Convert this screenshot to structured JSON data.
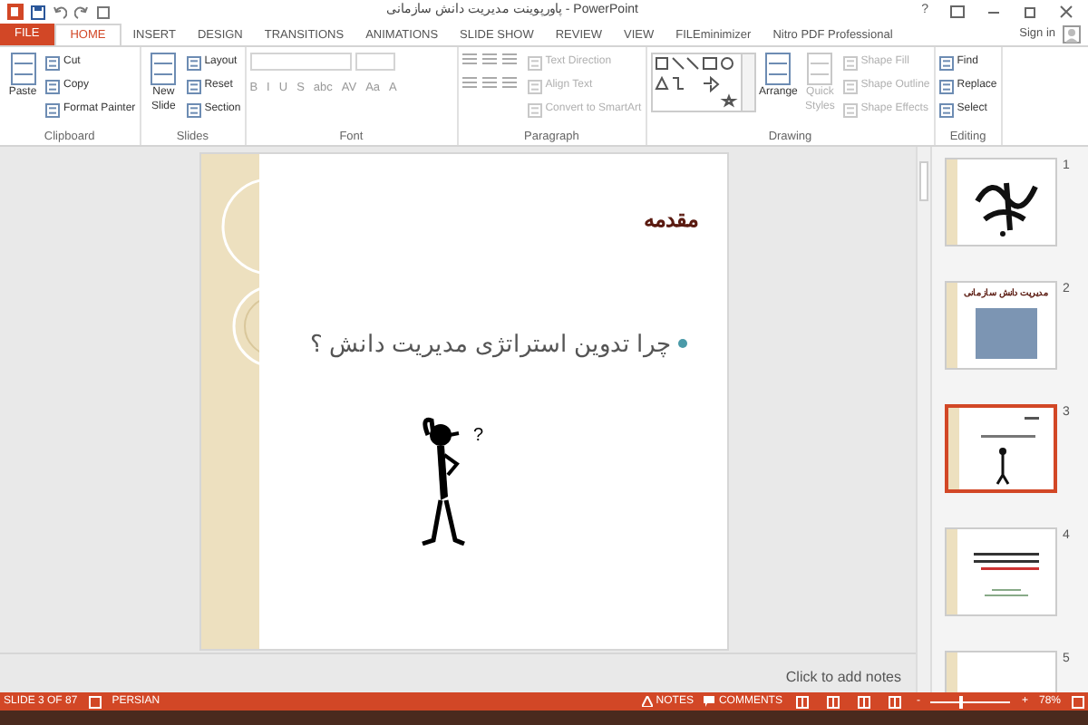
{
  "window": {
    "title": "پاورپوینت مدیریت دانش سازمانی - PowerPoint",
    "help": "?",
    "sign_in": "Sign in"
  },
  "tabs": [
    {
      "label": "FILE",
      "kind": "file"
    },
    {
      "label": "HOME",
      "kind": "tab",
      "selected": true
    },
    {
      "label": "INSERT",
      "kind": "tab",
      "selected": false
    },
    {
      "label": "DESIGN",
      "kind": "tab",
      "selected": false
    },
    {
      "label": "TRANSITIONS",
      "kind": "tab",
      "selected": false
    },
    {
      "label": "ANIMATIONS",
      "kind": "tab",
      "selected": false
    },
    {
      "label": "SLIDE SHOW",
      "kind": "tab",
      "selected": false
    },
    {
      "label": "REVIEW",
      "kind": "tab",
      "selected": false
    },
    {
      "label": "VIEW",
      "kind": "tab",
      "selected": false
    },
    {
      "label": "FILEminimizer",
      "kind": "tab",
      "selected": false
    },
    {
      "label": "Nitro PDF Professional",
      "kind": "tab",
      "selected": false
    }
  ],
  "ribbon": {
    "groups": [
      {
        "label": "Clipboard",
        "items": [
          {
            "kind": "large",
            "label": "Paste",
            "disabled": false
          },
          {
            "kind": "small",
            "label": "Cut",
            "disabled": false
          },
          {
            "kind": "small",
            "label": "Copy",
            "disabled": false
          },
          {
            "kind": "small",
            "label": "Format Painter",
            "disabled": false
          }
        ]
      },
      {
        "label": "Slides",
        "items": [
          {
            "kind": "large",
            "label": "New Slide",
            "disabled": false
          },
          {
            "kind": "small",
            "label": "Layout",
            "disabled": false
          },
          {
            "kind": "small",
            "label": "Reset",
            "disabled": false
          },
          {
            "kind": "small",
            "label": "Section",
            "disabled": false
          }
        ]
      },
      {
        "label": "Font",
        "items": [
          {
            "kind": "font",
            "glyphs": [
              "B",
              "I",
              "U",
              "S",
              "abc",
              "AV",
              "Aa",
              "A"
            ]
          }
        ]
      },
      {
        "label": "Paragraph",
        "items": [
          {
            "kind": "paragraph"
          },
          {
            "kind": "small",
            "label": "Text Direction",
            "disabled": true
          },
          {
            "kind": "small",
            "label": "Align Text",
            "disabled": true
          },
          {
            "kind": "small",
            "label": "Convert to SmartArt",
            "disabled": true
          }
        ]
      },
      {
        "label": "Drawing",
        "items": [
          {
            "kind": "shapes"
          },
          {
            "kind": "large",
            "label": "Arrange",
            "disabled": false
          },
          {
            "kind": "large",
            "label": "Quick Styles",
            "disabled": true
          },
          {
            "kind": "small",
            "label": "Shape Fill",
            "disabled": true
          },
          {
            "kind": "small",
            "label": "Shape Outline",
            "disabled": true
          },
          {
            "kind": "small",
            "label": "Shape Effects",
            "disabled": true
          }
        ]
      },
      {
        "label": "Editing",
        "items": [
          {
            "kind": "small",
            "label": "Find",
            "disabled": false
          },
          {
            "kind": "small",
            "label": "Replace",
            "disabled": false
          },
          {
            "kind": "small",
            "label": "Select",
            "disabled": false
          }
        ]
      }
    ]
  },
  "slide": {
    "title": "مقدمه",
    "bullet": "چرا تدوین استراتژی مدیریت دانش ؟",
    "figure_mark": "?"
  },
  "notes": {
    "placeholder": "Click to add notes"
  },
  "thumbnails": [
    {
      "number": "1",
      "kind": "calligraphy",
      "selected": false
    },
    {
      "number": "2",
      "kind": "photo",
      "title": "مدیریت دانش سازمانی",
      "selected": false
    },
    {
      "number": "3",
      "kind": "figure",
      "selected": true
    },
    {
      "number": "4",
      "kind": "text",
      "selected": false
    },
    {
      "number": "5",
      "kind": "blank",
      "selected": false
    }
  ],
  "status_bar": {
    "slide": "SLIDE 3 OF 87",
    "language": "PERSIAN",
    "notes": "NOTES",
    "comments": "COMMENTS",
    "zoom": {
      "minus": "-",
      "plus": "+",
      "level": 0.35,
      "reading": "78%"
    }
  }
}
